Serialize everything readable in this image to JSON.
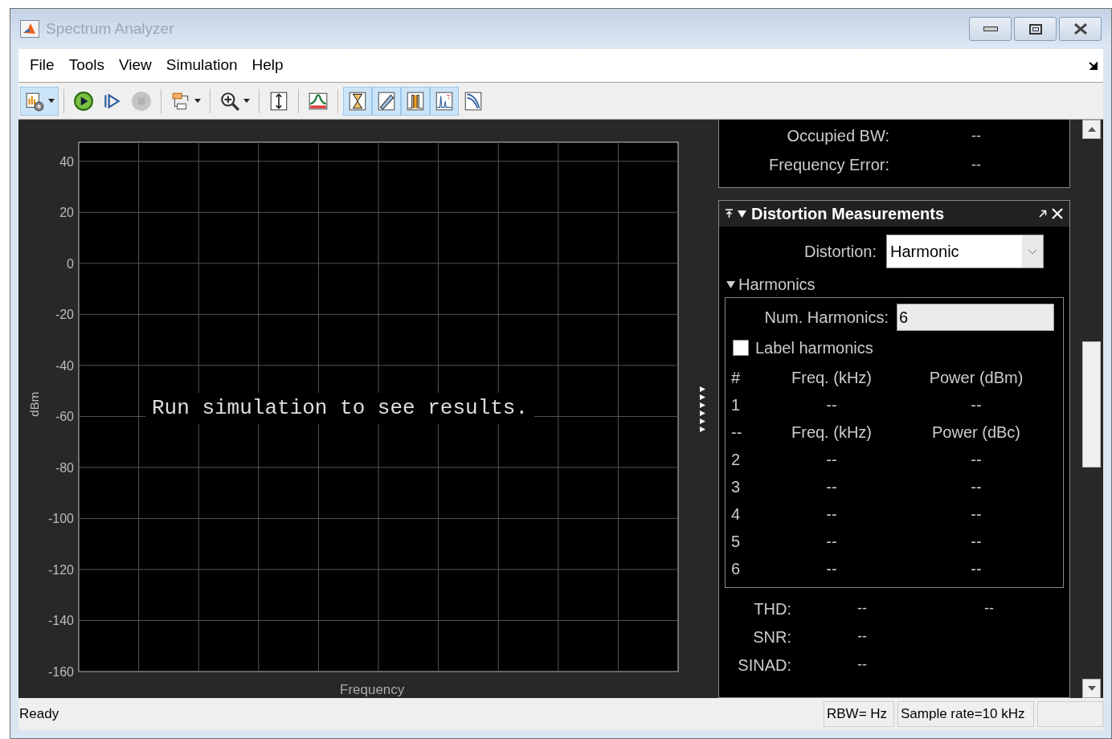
{
  "window": {
    "title": "Spectrum Analyzer"
  },
  "menu": [
    {
      "label": "File"
    },
    {
      "label": "Tools"
    },
    {
      "label": "View"
    },
    {
      "label": "Simulation"
    },
    {
      "label": "Help"
    }
  ],
  "toolbar": [
    [
      {
        "selected": true,
        "dropdown": true
      }
    ],
    [
      {
        "selected": false,
        "dropdown": false
      },
      {
        "selected": false,
        "dropdown": false
      },
      {
        "selected": false,
        "dropdown": false,
        "disabled": true
      }
    ],
    [
      {
        "selected": false,
        "dropdown": true
      }
    ],
    [
      {
        "selected": false,
        "dropdown": true
      }
    ],
    [
      {
        "selected": false,
        "dropdown": false
      }
    ],
    [
      {
        "selected": false,
        "dropdown": false
      }
    ],
    [
      {
        "selected": true,
        "dropdown": false
      },
      {
        "selected": true,
        "dropdown": false
      },
      {
        "selected": true,
        "dropdown": false
      },
      {
        "selected": true,
        "dropdown": false
      },
      {
        "selected": false,
        "dropdown": false
      }
    ]
  ],
  "plot": {
    "message": "Run simulation to see results.",
    "chart_data": {
      "type": "line",
      "categories": [
        null,
        null
      ],
      "series": [
        {
          "values": [
            null,
            null
          ]
        }
      ],
      "grid": true,
      "xlabel": "Frequency",
      "ylabel": "dBm",
      "ylim": [
        -160,
        47.5
      ],
      "yticks": [
        40,
        20,
        0,
        -20,
        -40,
        -60,
        -80,
        -100,
        -120,
        -140,
        -160
      ]
    }
  },
  "channel_measurements": {
    "rows": [
      {
        "label": "Occupied BW:",
        "value": "--"
      },
      {
        "label": "Frequency Error:",
        "value": "--"
      }
    ]
  },
  "distortion": {
    "title": "Distortion Measurements",
    "distortion_label": "Distortion:",
    "distortion_value": "Harmonic",
    "section": "Harmonics",
    "expanded": true,
    "num_label": "Num. Harmonics:",
    "num_value": "6",
    "label_harmonics": {
      "label": "Label harmonics",
      "checked": false
    },
    "table": {
      "rows": [
        [
          "#",
          "Freq. (kHz)",
          "Power (dBm)"
        ],
        [
          "1",
          "--",
          "--"
        ],
        [
          "--",
          "Freq. (kHz)",
          "Power (dBc)"
        ],
        [
          "2",
          "--",
          "--"
        ],
        [
          "3",
          "--",
          "--"
        ],
        [
          "4",
          "--",
          "--"
        ],
        [
          "5",
          "--",
          "--"
        ],
        [
          "6",
          "--",
          "--"
        ]
      ]
    },
    "summary": [
      {
        "label": "THD:",
        "values": [
          "--",
          "--"
        ]
      },
      {
        "label": "SNR:",
        "values": [
          "--"
        ]
      },
      {
        "label": "SINAD:",
        "values": [
          "--"
        ]
      }
    ]
  },
  "status_bar": {
    "text": "Ready",
    "fields": [
      "RBW= Hz",
      "Sample rate=10 kHz"
    ]
  }
}
